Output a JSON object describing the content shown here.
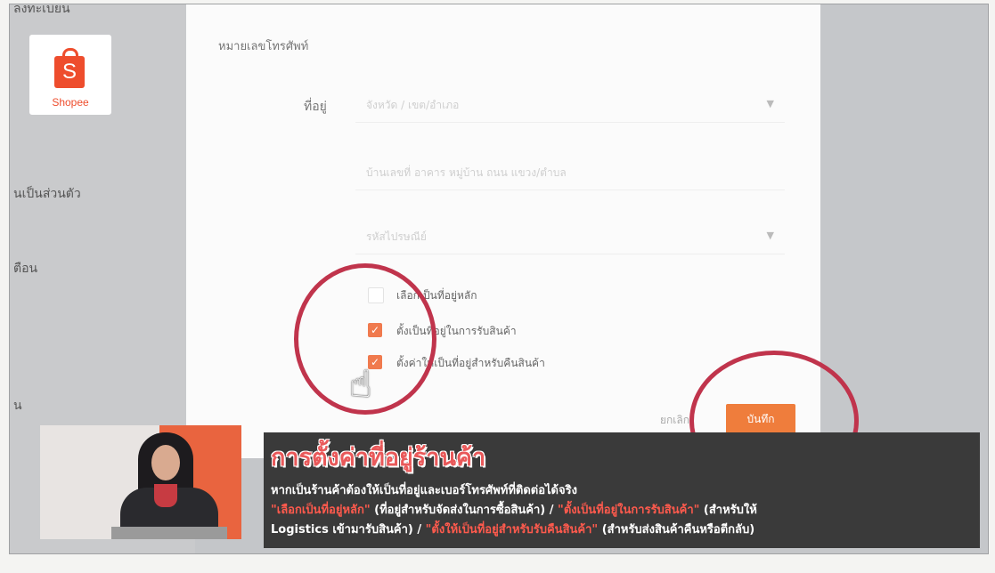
{
  "sidebar": {
    "top_partial": "ลงทะเบียน",
    "item1": "นเป็นส่วนตัว",
    "item2": "ตือน",
    "item3": "น",
    "logo_text": "Shopee",
    "logo_letter": "S"
  },
  "form": {
    "phone_label": "หมายเลขโทรศัพท์",
    "address_label": "ที่อยู่",
    "province_placeholder": "จังหวัด / เขต/อำเภอ",
    "detail_placeholder": "บ้านเลขที่ อาคาร หมู่บ้าน ถนน แขวง/ตำบล",
    "postcode_placeholder": "รหัสไปรษณีย์",
    "options": [
      {
        "label": "เลือกเป็นที่อยู่หลัก",
        "checked": false
      },
      {
        "label": "ตั้งเป็นที่อยู่ในการรับสินค้า",
        "checked": true
      },
      {
        "label": "ตั้งค่าให้เป็นที่อยู่สำหรับคืนสินค้า",
        "checked": true
      }
    ],
    "cancel_label": "ยกเลิก",
    "save_label": "บันทึก"
  },
  "caption": {
    "title": "การตั้งค่าที่อยู่ร้านค้า",
    "line1": "หากเป็นร้านค้าต้องให้เป็นที่อยู่และเบอร์โทรศัพท์ที่ติดต่อได้จริง",
    "line2_a": "\"เลือกเป็นที่อยู่หลัก\"",
    "line2_b": " (ที่อยู่สำหรับจัดส่งในการซื้อสินค้า) / ",
    "line2_c": "\"ตั้งเป็นที่อยู่ในการรับสินค้า\"",
    "line2_d": " (สำหรับให้",
    "line3_a": "Logistics เข้ามารับสินค้า) / ",
    "line3_b": "\"ตั้งให้เป็นที่อยู่สำหรับรับคืนสินค้า\"",
    "line3_c": " (สำหรับส่งสินค้าคืนหรือตีกลับ)"
  },
  "colors": {
    "brand": "#ee4d2d",
    "highlight_circle": "#c0344c",
    "save_button": "#ef7d3c",
    "caption_bg": "#3a3a3a"
  }
}
